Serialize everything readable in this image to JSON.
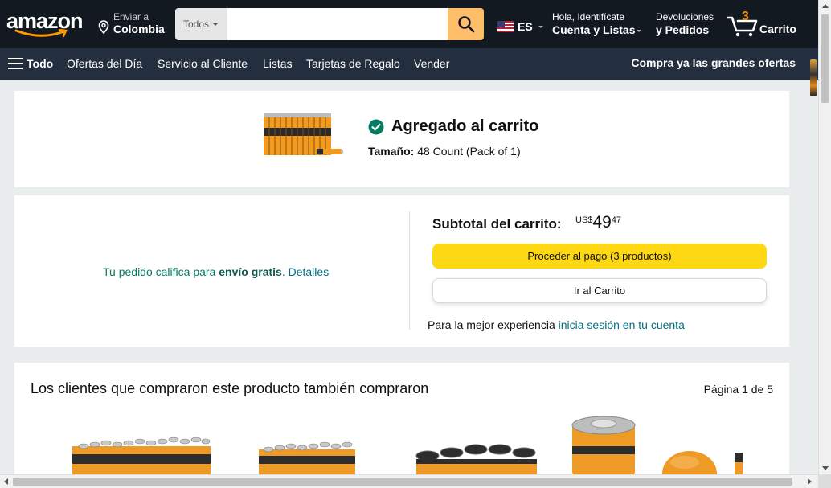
{
  "header": {
    "logo_text": "amazon",
    "deliver_line1": "Enviar a",
    "deliver_line2": "Colombia",
    "search": {
      "category": "Todos",
      "placeholder": "",
      "value": ""
    },
    "language": "ES",
    "account_line1": "Hola, Identifícate",
    "account_line2": "Cuenta y Listas",
    "returns_line1": "Devoluciones",
    "returns_line2": "y Pedidos",
    "cart_count": "3",
    "cart_label": "Carrito"
  },
  "subnav": {
    "all_label": "Todo",
    "links": [
      "Ofertas del Día",
      "Servicio al Cliente",
      "Listas",
      "Tarjetas de Regalo",
      "Vender"
    ],
    "promo": "Compra ya las grandes ofertas"
  },
  "added": {
    "title": "Agregado al carrito",
    "size_label": "Tamaño:",
    "size_value": "48 Count (Pack of 1)"
  },
  "subtotal": {
    "free_prefix": "Tu pedido califica para",
    "free_bold": "envío gratis",
    "free_dot": ".",
    "free_link": "Detalles",
    "label": "Subtotal del carrito:",
    "currency": "US$",
    "whole": "49",
    "cents": "47",
    "checkout_button": "Proceder al pago (3 productos)",
    "cart_button": "Ir al Carrito",
    "signin_prefix": "Para la mejor experiencia",
    "signin_link": "inicia sesión en tu cuenta"
  },
  "recommendations": {
    "heading": "Los clientes que compraron este producto también compraron",
    "pager": "Página 1 de 5"
  },
  "colors": {
    "header_bg": "#131921",
    "subnav_bg": "#232f3e",
    "search_button": "#febd69",
    "checkout_button": "#ffd814",
    "link": "#007185",
    "success": "#067d62",
    "cart_count": "#f08804"
  }
}
